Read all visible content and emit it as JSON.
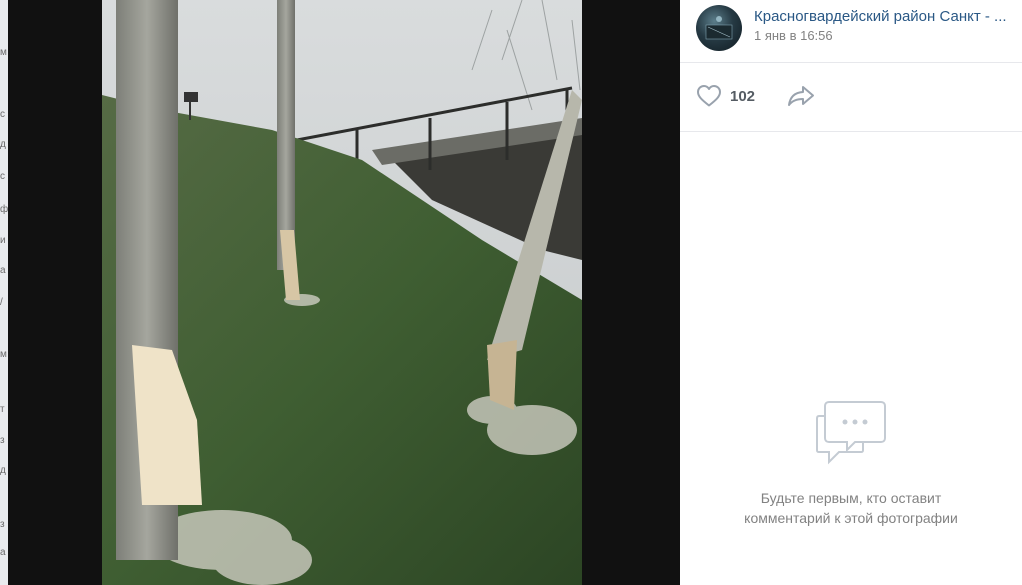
{
  "post": {
    "author": "Красногвардейский район Санкт - ...",
    "date": "1 янв в 16:56",
    "avatar_icon": "community-avatar"
  },
  "actions": {
    "like_icon": "heart-icon",
    "like_count": "102",
    "share_icon": "share-arrow-icon"
  },
  "comments": {
    "empty_icon": "chat-bubbles-icon",
    "empty_line1": "Будьте первым, кто оставит",
    "empty_line2": "комментарий к этой фотографии"
  },
  "colors": {
    "link": "#2a5885",
    "secondary_text": "#828282",
    "divider": "#e7e8ec",
    "icon": "#99a2ad"
  }
}
